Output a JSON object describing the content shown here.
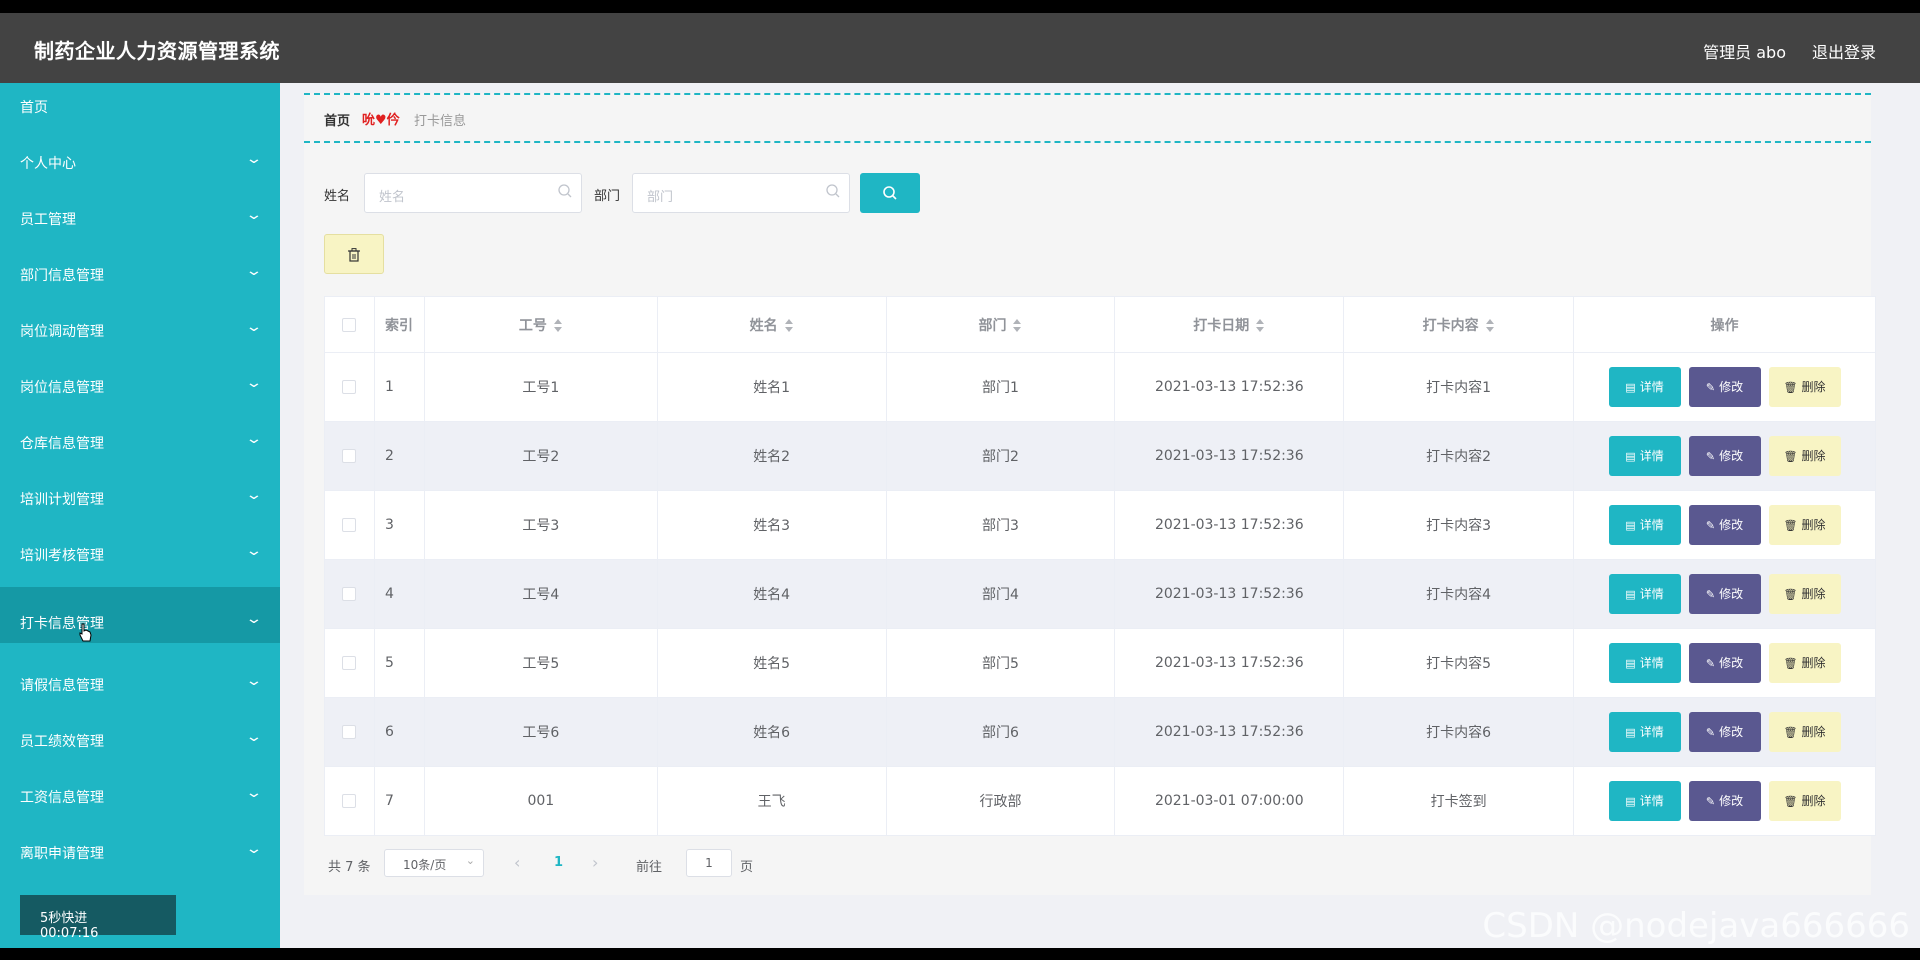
{
  "header": {
    "title": "制药企业人力资源管理系统",
    "user": "管理员 abo",
    "logout": "退出登录"
  },
  "sidebar": {
    "items": [
      {
        "label": "首页",
        "chevron": false
      },
      {
        "label": "个人中心",
        "chevron": true
      },
      {
        "label": "员工管理",
        "chevron": true
      },
      {
        "label": "部门信息管理",
        "chevron": true
      },
      {
        "label": "岗位调动管理",
        "chevron": true
      },
      {
        "label": "岗位信息管理",
        "chevron": true
      },
      {
        "label": "仓库信息管理",
        "chevron": true
      },
      {
        "label": "培训计划管理",
        "chevron": true
      },
      {
        "label": "培训考核管理",
        "chevron": true
      },
      {
        "label": "打卡信息管理",
        "chevron": true,
        "active": true
      },
      {
        "label": "请假信息管理",
        "chevron": true
      },
      {
        "label": "员工绩效管理",
        "chevron": true
      },
      {
        "label": "工资信息管理",
        "chevron": true
      },
      {
        "label": "离职申请管理",
        "chevron": true
      }
    ],
    "timer": {
      "label": "5秒快进",
      "time": "00:07:16"
    }
  },
  "breadcrumb": {
    "home": "首页",
    "separator": "♥",
    "current": "打卡信息"
  },
  "search": {
    "name_label": "姓名",
    "name_placeholder": "姓名",
    "dept_label": "部门",
    "dept_placeholder": "部门"
  },
  "table": {
    "headers": [
      "索引",
      "工号",
      "姓名",
      "部门",
      "打卡日期",
      "打卡内容",
      "操作"
    ],
    "rows": [
      {
        "index": "1",
        "id": "工号1",
        "name": "姓名1",
        "dept": "部门1",
        "date": "2021-03-13 17:52:36",
        "content": "打卡内容1"
      },
      {
        "index": "2",
        "id": "工号2",
        "name": "姓名2",
        "dept": "部门2",
        "date": "2021-03-13 17:52:36",
        "content": "打卡内容2"
      },
      {
        "index": "3",
        "id": "工号3",
        "name": "姓名3",
        "dept": "部门3",
        "date": "2021-03-13 17:52:36",
        "content": "打卡内容3"
      },
      {
        "index": "4",
        "id": "工号4",
        "name": "姓名4",
        "dept": "部门4",
        "date": "2021-03-13 17:52:36",
        "content": "打卡内容4"
      },
      {
        "index": "5",
        "id": "工号5",
        "name": "姓名5",
        "dept": "部门5",
        "date": "2021-03-13 17:52:36",
        "content": "打卡内容5"
      },
      {
        "index": "6",
        "id": "工号6",
        "name": "姓名6",
        "dept": "部门6",
        "date": "2021-03-13 17:52:36",
        "content": "打卡内容6"
      },
      {
        "index": "7",
        "id": "001",
        "name": "王飞",
        "dept": "行政部",
        "date": "2021-03-01 07:00:00",
        "content": "打卡签到"
      }
    ],
    "actions": {
      "detail": "详情",
      "edit": "修改",
      "delete": "删除"
    }
  },
  "pagination": {
    "total": "共 7 条",
    "page_size": "10条/页",
    "current_page": "1",
    "goto_label": "前往",
    "goto_value": "1",
    "page_suffix": "页"
  },
  "watermark": "CSDN @nodejava666666",
  "colors": {
    "header": "#434343",
    "sidebar": "#1fb6c4",
    "sidebar_active": "#1599a5",
    "detail_button": "#1fb6c4",
    "edit_button": "#5a5890",
    "delete_button": "#f8f4c4"
  }
}
